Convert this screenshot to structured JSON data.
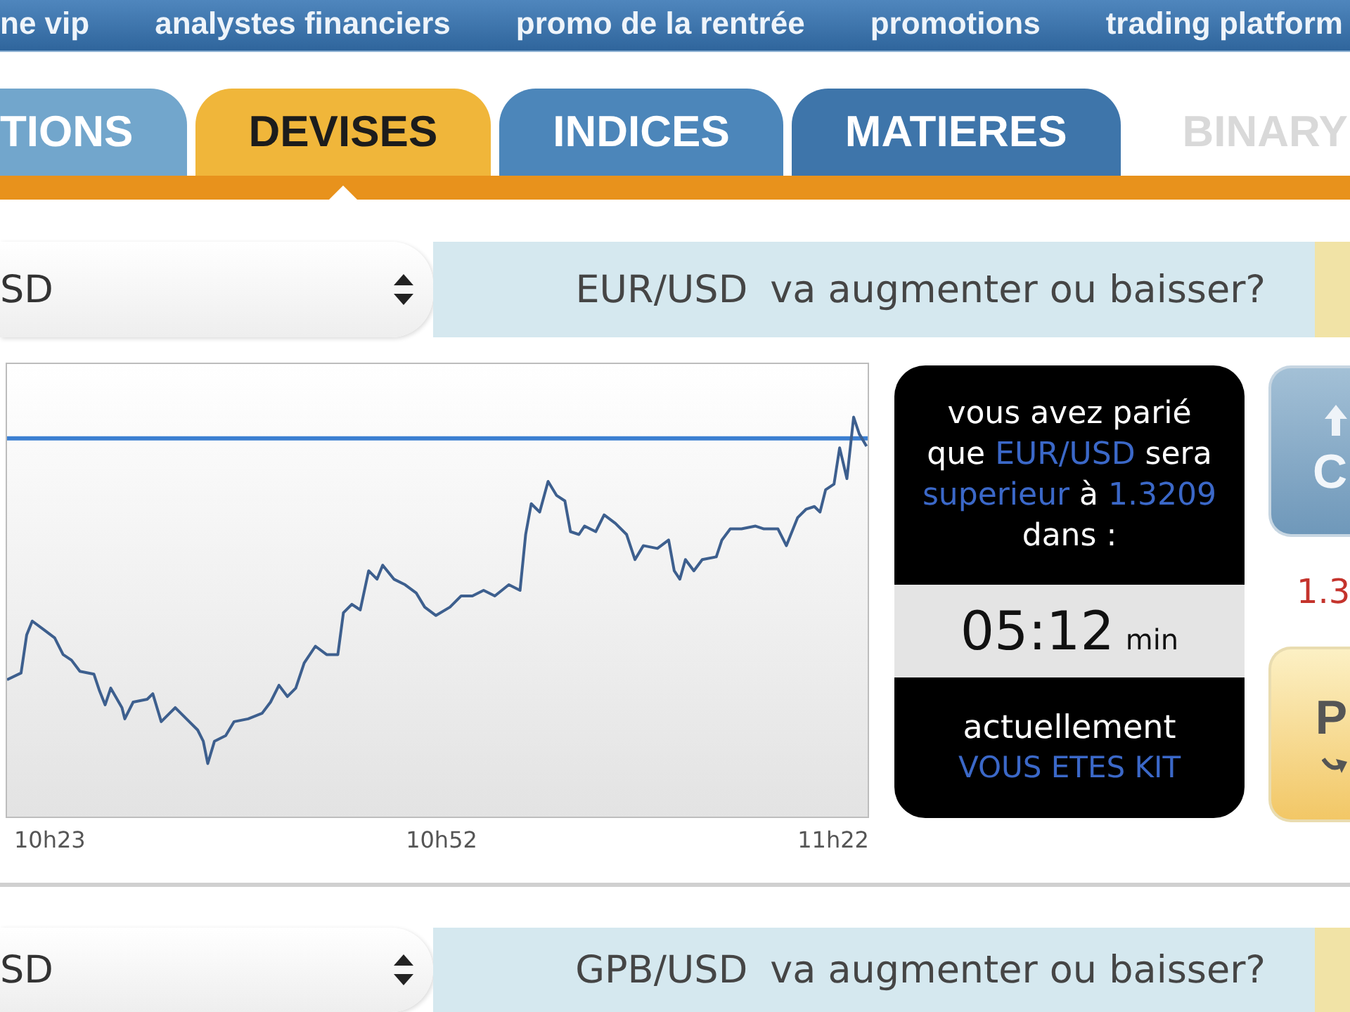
{
  "top_nav": [
    {
      "label": "ne vip"
    },
    {
      "label": "analystes financiers"
    },
    {
      "label": "promo de la rentrée"
    },
    {
      "label": "promotions"
    },
    {
      "label": "trading platform"
    }
  ],
  "tabs": [
    {
      "label": "TIONS",
      "selected": false,
      "disabled": false,
      "color": "#72a6cc"
    },
    {
      "label": "DEVISES",
      "selected": true,
      "disabled": false,
      "color": "#f0b63a"
    },
    {
      "label": "INDICES",
      "selected": false,
      "disabled": false,
      "color": "#4c86ba"
    },
    {
      "label": "MATIERES",
      "selected": false,
      "disabled": false,
      "color": "#3e75aa"
    },
    {
      "label": "BINARY",
      "selected": false,
      "disabled": true
    }
  ],
  "markets": [
    {
      "select_value": "SD",
      "pair": "EUR/USD",
      "question": "va augmenter ou baisser?",
      "chart": {
        "x_labels": [
          "10h23",
          "10h52",
          "11h22"
        ]
      },
      "bet": {
        "message": [
          [
            {
              "text": "vous avez parié",
              "highlight": false
            }
          ],
          [
            {
              "text": "que ",
              "highlight": false
            },
            {
              "text": "EUR/USD",
              "highlight": true
            },
            {
              "text": " sera",
              "highlight": false
            }
          ],
          [
            {
              "text": "superieur",
              "highlight": true
            },
            {
              "text": " à ",
              "highlight": false
            },
            {
              "text": "1.3209",
              "highlight": true
            }
          ],
          [
            {
              "text": "dans :",
              "highlight": false
            }
          ]
        ],
        "countdown": "05:12",
        "countdown_unit": "min",
        "status_label": "actuellement",
        "status_value": "VOUS ETES KIT"
      },
      "call_label": "C",
      "price": "1.3",
      "put_label": "P"
    },
    {
      "select_value": "SD",
      "pair": "GPB/USD",
      "question": "va augmenter ou baisser?"
    }
  ]
}
